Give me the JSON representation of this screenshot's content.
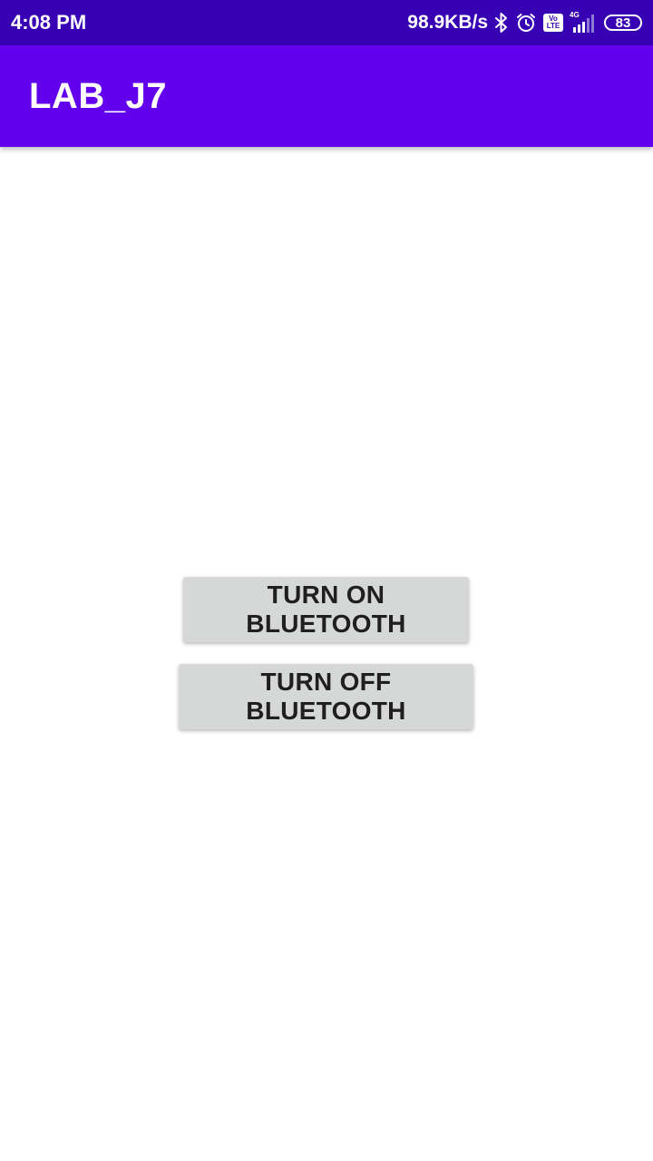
{
  "status_bar": {
    "time": "4:08 PM",
    "network_speed": "98.9KB/s",
    "icons": [
      "bluetooth-icon",
      "alarm-icon",
      "volte-icon",
      "signal-icon",
      "battery-icon"
    ],
    "volte_top": "Vo",
    "volte_bottom": "LTE",
    "network_type": "4G",
    "battery_level": "83"
  },
  "app_bar": {
    "title": "LAB_J7"
  },
  "buttons": {
    "turn_on": "TURN ON BLUETOOTH",
    "turn_off": "TURN OFF BLUETOOTH"
  },
  "colors": {
    "status_bar": "#3700b3",
    "app_bar": "#6200ee",
    "button_bg": "#d6d7d7",
    "button_text": "#1f1f1f"
  }
}
